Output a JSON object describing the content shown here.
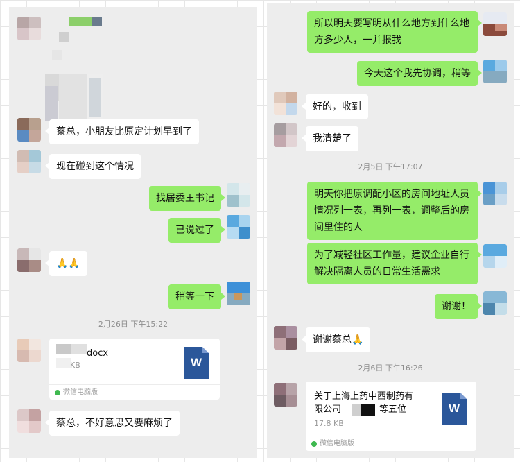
{
  "left": {
    "messages": [
      {
        "text": "蔡总，小朋友比原定计划早到了"
      },
      {
        "text": "现在碰到这个情况"
      },
      {
        "text": "找居委王书记"
      },
      {
        "text": "已说过了"
      },
      {
        "text": "🙏🙏"
      },
      {
        "text": "稍等一下"
      },
      {
        "text": "蔡总，不好意思又要麻烦了"
      }
    ],
    "timestamp": "2月26日 下午15:22",
    "file": {
      "name": "docx",
      "size": "KB",
      "icon_letter": "W",
      "source": "微信电脑版"
    }
  },
  "right": {
    "messages": [
      {
        "text": "所以明天要写明从什么地方到什么地方多少人，一并报我"
      },
      {
        "text": "今天这个我先协调，稍等"
      },
      {
        "text": "好的，收到"
      },
      {
        "text": "我清楚了"
      },
      {
        "text": "明天你把原调配小区的房间地址人员情况列一表，再列一表，调整后的房间里住的人"
      },
      {
        "text": "为了减轻社区工作量，建议企业自行解决隔离人员的日常生活需求"
      },
      {
        "text": "谢谢！"
      },
      {
        "text": "谢谢蔡总🙏"
      }
    ],
    "timestamp1": "2月5日 下午17:07",
    "timestamp2": "2月6日 下午16:26",
    "file": {
      "name_line1": "关于上海上药中西制药有",
      "name_line2": "限公司",
      "name_line2b": "等五位",
      "size": "17.8 KB",
      "icon_letter": "W",
      "source": "微信电脑版"
    }
  },
  "colors": {
    "outgoing_bubble": "#95ec69",
    "incoming_bubble": "#ffffff",
    "chat_background": "#ededed",
    "word_icon": "#2b579a"
  }
}
